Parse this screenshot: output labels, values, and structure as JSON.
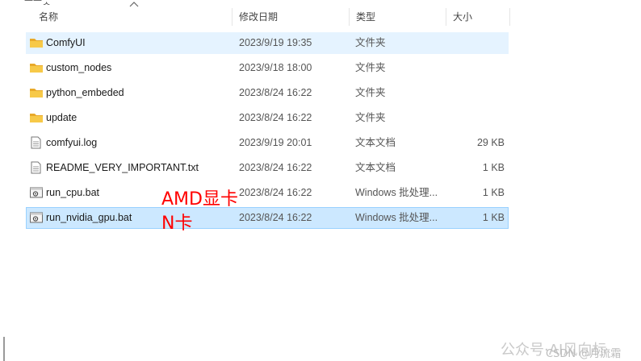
{
  "breadcrumb_fragment": "ᅳᅳᆺ",
  "columns": {
    "name": "名称",
    "modified": "修改日期",
    "type": "类型",
    "size": "大小"
  },
  "files": [
    {
      "name": "ComfyUI",
      "date": "2023/9/19 19:35",
      "type": "文件夹",
      "size": "",
      "icon": "folder-icon",
      "state": "hover"
    },
    {
      "name": "custom_nodes",
      "date": "2023/9/18 18:00",
      "type": "文件夹",
      "size": "",
      "icon": "folder-icon",
      "state": ""
    },
    {
      "name": "python_embeded",
      "date": "2023/8/24 16:22",
      "type": "文件夹",
      "size": "",
      "icon": "folder-icon",
      "state": ""
    },
    {
      "name": "update",
      "date": "2023/8/24 16:22",
      "type": "文件夹",
      "size": "",
      "icon": "folder-icon",
      "state": ""
    },
    {
      "name": "comfyui.log",
      "date": "2023/9/19 20:01",
      "type": "文本文档",
      "size": "29 KB",
      "icon": "text-file-icon",
      "state": ""
    },
    {
      "name": "README_VERY_IMPORTANT.txt",
      "date": "2023/8/24 16:22",
      "type": "文本文档",
      "size": "1 KB",
      "icon": "text-file-icon",
      "state": ""
    },
    {
      "name": "run_cpu.bat",
      "date": "2023/8/24 16:22",
      "type": "Windows 批处理...",
      "size": "1 KB",
      "icon": "batch-file-icon",
      "state": ""
    },
    {
      "name": "run_nvidia_gpu.bat",
      "date": "2023/8/24 16:22",
      "type": "Windows 批处理...",
      "size": "1 KB",
      "icon": "batch-file-icon",
      "state": "selected"
    }
  ],
  "annotations": {
    "amd": "AMD显卡",
    "nvidia": "N卡"
  },
  "watermark": {
    "main": "公众号·AI风向标",
    "csdn": "CSDN @月流霜"
  },
  "colors": {
    "hover": "#e5f3ff",
    "selected": "#cce8ff",
    "annotation": "#ff0000",
    "folder": "#f3c244"
  }
}
